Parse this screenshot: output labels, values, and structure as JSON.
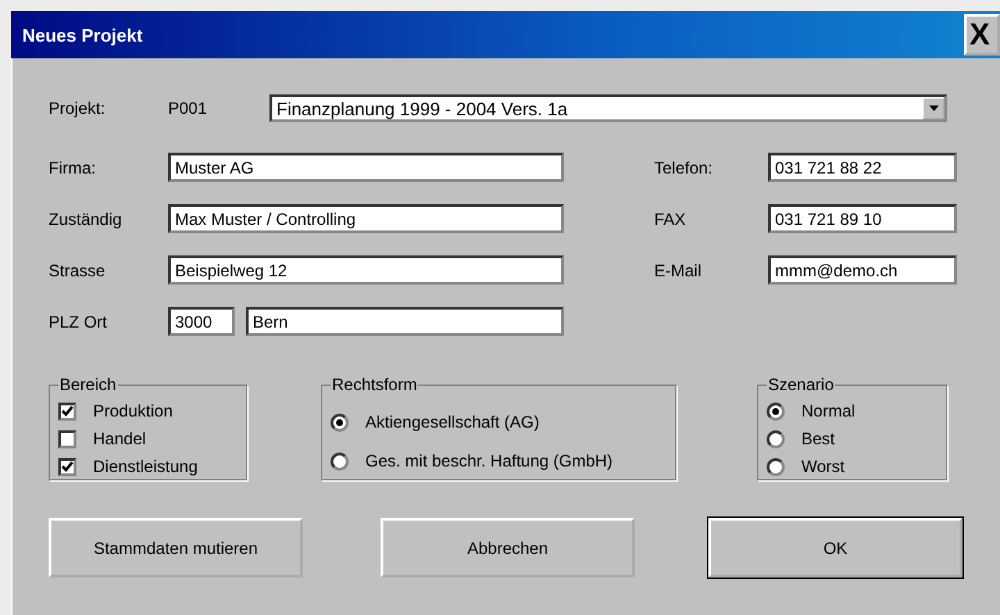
{
  "window": {
    "title": "Neues Projekt",
    "close": "X"
  },
  "project": {
    "label": "Projekt:",
    "code": "P001",
    "value": "Finanzplanung 1999 - 2004 Vers. 1a"
  },
  "left_fields": [
    {
      "label": "Firma:",
      "value": "Muster AG"
    },
    {
      "label": "Zuständig",
      "value": "Max Muster / Controlling"
    },
    {
      "label": "Strasse",
      "value": "Beispielweg 12"
    }
  ],
  "plz_ort": {
    "label": "PLZ Ort",
    "plz": "3000",
    "ort": "Bern"
  },
  "right_fields": [
    {
      "label": "Telefon:",
      "value": "031 721 88 22"
    },
    {
      "label": "FAX",
      "value": "031 721 89 10"
    },
    {
      "label": "E-Mail",
      "value": "mmm@demo.ch"
    }
  ],
  "bereich": {
    "title": "Bereich",
    "items": [
      {
        "label": "Produktion",
        "checked": true
      },
      {
        "label": "Handel",
        "checked": false
      },
      {
        "label": "Dienstleistung",
        "checked": true
      }
    ]
  },
  "rechtsform": {
    "title": "Rechtsform",
    "items": [
      {
        "label": "Aktiengesellschaft (AG)",
        "selected": true
      },
      {
        "label": "Ges. mit beschr. Haftung (GmbH)",
        "selected": false
      }
    ]
  },
  "szenario": {
    "title": "Szenario",
    "items": [
      {
        "label": "Normal",
        "selected": true
      },
      {
        "label": "Best",
        "selected": false
      },
      {
        "label": "Worst",
        "selected": false
      }
    ]
  },
  "buttons": [
    {
      "label": "Stammdaten mutieren",
      "default": false
    },
    {
      "label": "Abbrechen",
      "default": false
    },
    {
      "label": "OK",
      "default": true
    }
  ]
}
